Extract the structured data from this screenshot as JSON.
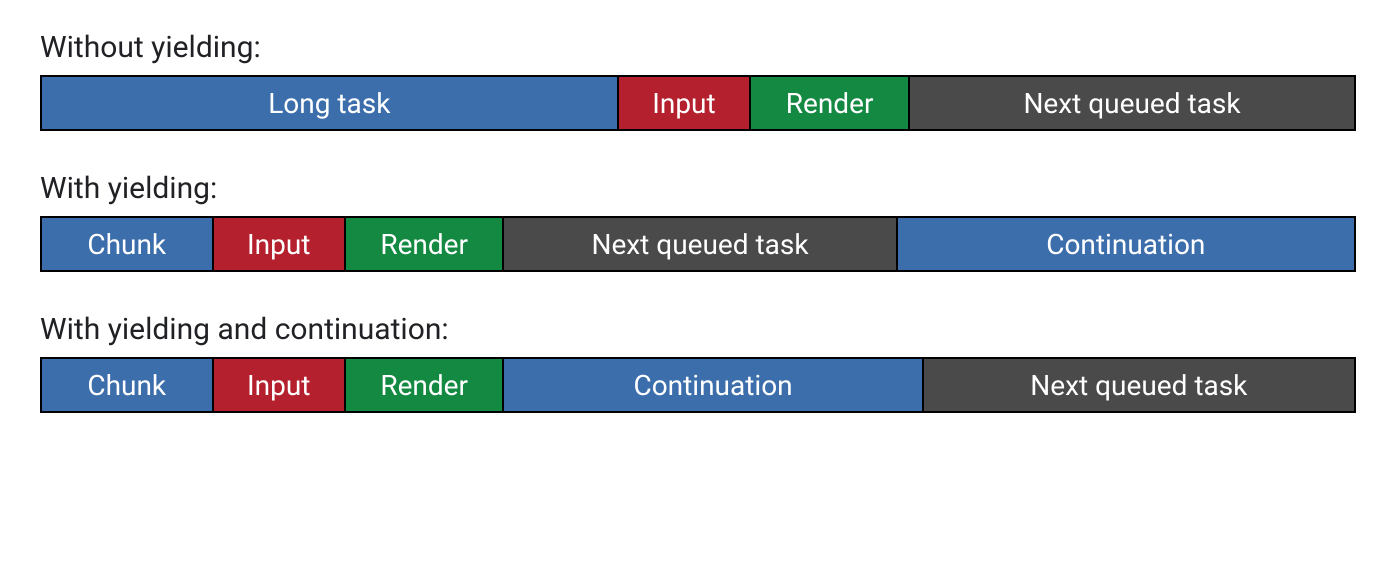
{
  "colors": {
    "blue": "#3c6eac",
    "red": "#b4202d",
    "green": "#148942",
    "gray": "#4a4a4a"
  },
  "rows": [
    {
      "label": "Without yielding:",
      "segments": [
        {
          "label": "Long task",
          "color": "blue",
          "flex": 44
        },
        {
          "label": "Input",
          "color": "red",
          "flex": 10
        },
        {
          "label": "Render",
          "color": "green",
          "flex": 12
        },
        {
          "label": "Next queued task",
          "color": "gray",
          "flex": 34
        }
      ]
    },
    {
      "label": "With yielding:",
      "segments": [
        {
          "label": "Chunk",
          "color": "blue",
          "flex": 13
        },
        {
          "label": "Input",
          "color": "red",
          "flex": 10
        },
        {
          "label": "Render",
          "color": "green",
          "flex": 12
        },
        {
          "label": "Next queued task",
          "color": "gray",
          "flex": 30
        },
        {
          "label": "Continuation",
          "color": "blue",
          "flex": 35
        }
      ]
    },
    {
      "label": "With yielding and continuation:",
      "segments": [
        {
          "label": "Chunk",
          "color": "blue",
          "flex": 13
        },
        {
          "label": "Input",
          "color": "red",
          "flex": 10
        },
        {
          "label": "Render",
          "color": "green",
          "flex": 12
        },
        {
          "label": "Continuation",
          "color": "blue",
          "flex": 32
        },
        {
          "label": "Next queued task",
          "color": "gray",
          "flex": 33
        }
      ]
    }
  ]
}
